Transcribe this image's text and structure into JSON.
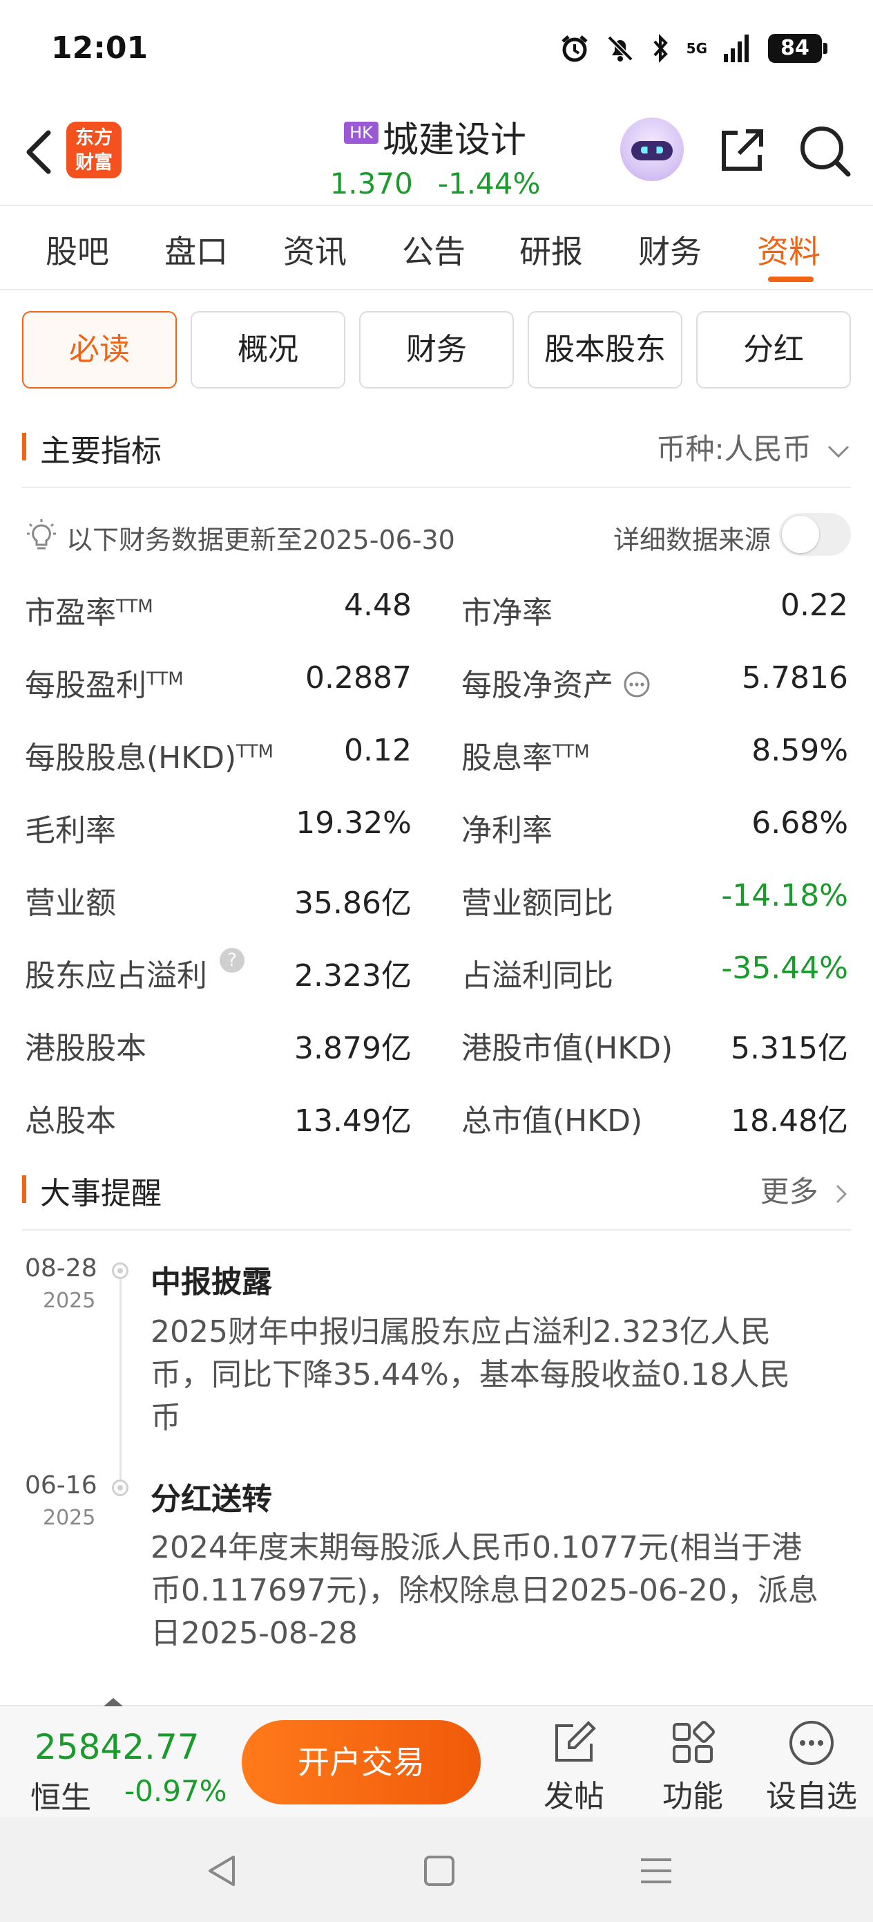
{
  "status": {
    "time": "12:01",
    "network": "5G",
    "battery": "84"
  },
  "header": {
    "logo": [
      "东方",
      "财富"
    ],
    "badge": "HK",
    "name": "城建设计",
    "price": "1.370",
    "change": "-1.44%"
  },
  "tabs": [
    "股吧",
    "盘口",
    "资讯",
    "公告",
    "研报",
    "财务",
    "资料"
  ],
  "active_tab": "资料",
  "subtabs": [
    "必读",
    "概况",
    "财务",
    "股本股东",
    "分红"
  ],
  "active_subtab": "必读",
  "main_indicators": {
    "title": "主要指标",
    "currency": "币种:人民币",
    "update_text": "以下财务数据更新至2025-06-30",
    "source_label": "详细数据来源",
    "ttm": "TTM",
    "metrics": [
      {
        "label": "市盈率",
        "value": "4.48"
      },
      {
        "label": "市净率",
        "value": "0.22"
      },
      {
        "label": "每股盈利",
        "value": "0.2887"
      },
      {
        "label": "每股净资产",
        "value": "5.7816"
      },
      {
        "label": "每股股息(HKD)",
        "value": "0.12"
      },
      {
        "label": "股息率",
        "value": "8.59%"
      },
      {
        "label": "毛利率",
        "value": "19.32%"
      },
      {
        "label": "净利率",
        "value": "6.68%"
      },
      {
        "label": "营业额",
        "value": "35.86亿"
      },
      {
        "label": "营业额同比",
        "value": "-14.18%"
      },
      {
        "label": "股东应占溢利",
        "value": "2.323亿"
      },
      {
        "label": "占溢利同比",
        "value": "-35.44%"
      },
      {
        "label": "港股股本",
        "value": "3.879亿"
      },
      {
        "label": "港股市值(HKD)",
        "value": "5.315亿"
      },
      {
        "label": "总股本",
        "value": "13.49亿"
      },
      {
        "label": "总市值(HKD)",
        "value": "18.48亿"
      }
    ]
  },
  "events": {
    "title": "大事提醒",
    "more": "更多",
    "items": [
      {
        "date": "08-28",
        "year": "2025",
        "title": "中报披露",
        "desc": [
          "2025财年中报归属股东应占溢利2.323亿人民",
          "币，同比下降35.44%，基本每股收益0.18人民",
          "币"
        ]
      },
      {
        "date": "06-16",
        "year": "2025",
        "title": "分红送转",
        "desc": [
          "2024年度末期每股派人民币0.1077元(相当于港",
          "币0.117697元)，除权除息日2025-06-20，派息",
          "日2025-08-28"
        ]
      }
    ]
  },
  "bottom": {
    "index_value": "25842.77",
    "index_name": "恒生",
    "index_change": "-0.97%",
    "open_button": "开户交易",
    "post": "发帖",
    "functions": "功能",
    "watchlist": "设自选"
  },
  "colors": {
    "accent": "#f06414",
    "down": "#1a9b2c",
    "badge": "#9b59d6"
  }
}
